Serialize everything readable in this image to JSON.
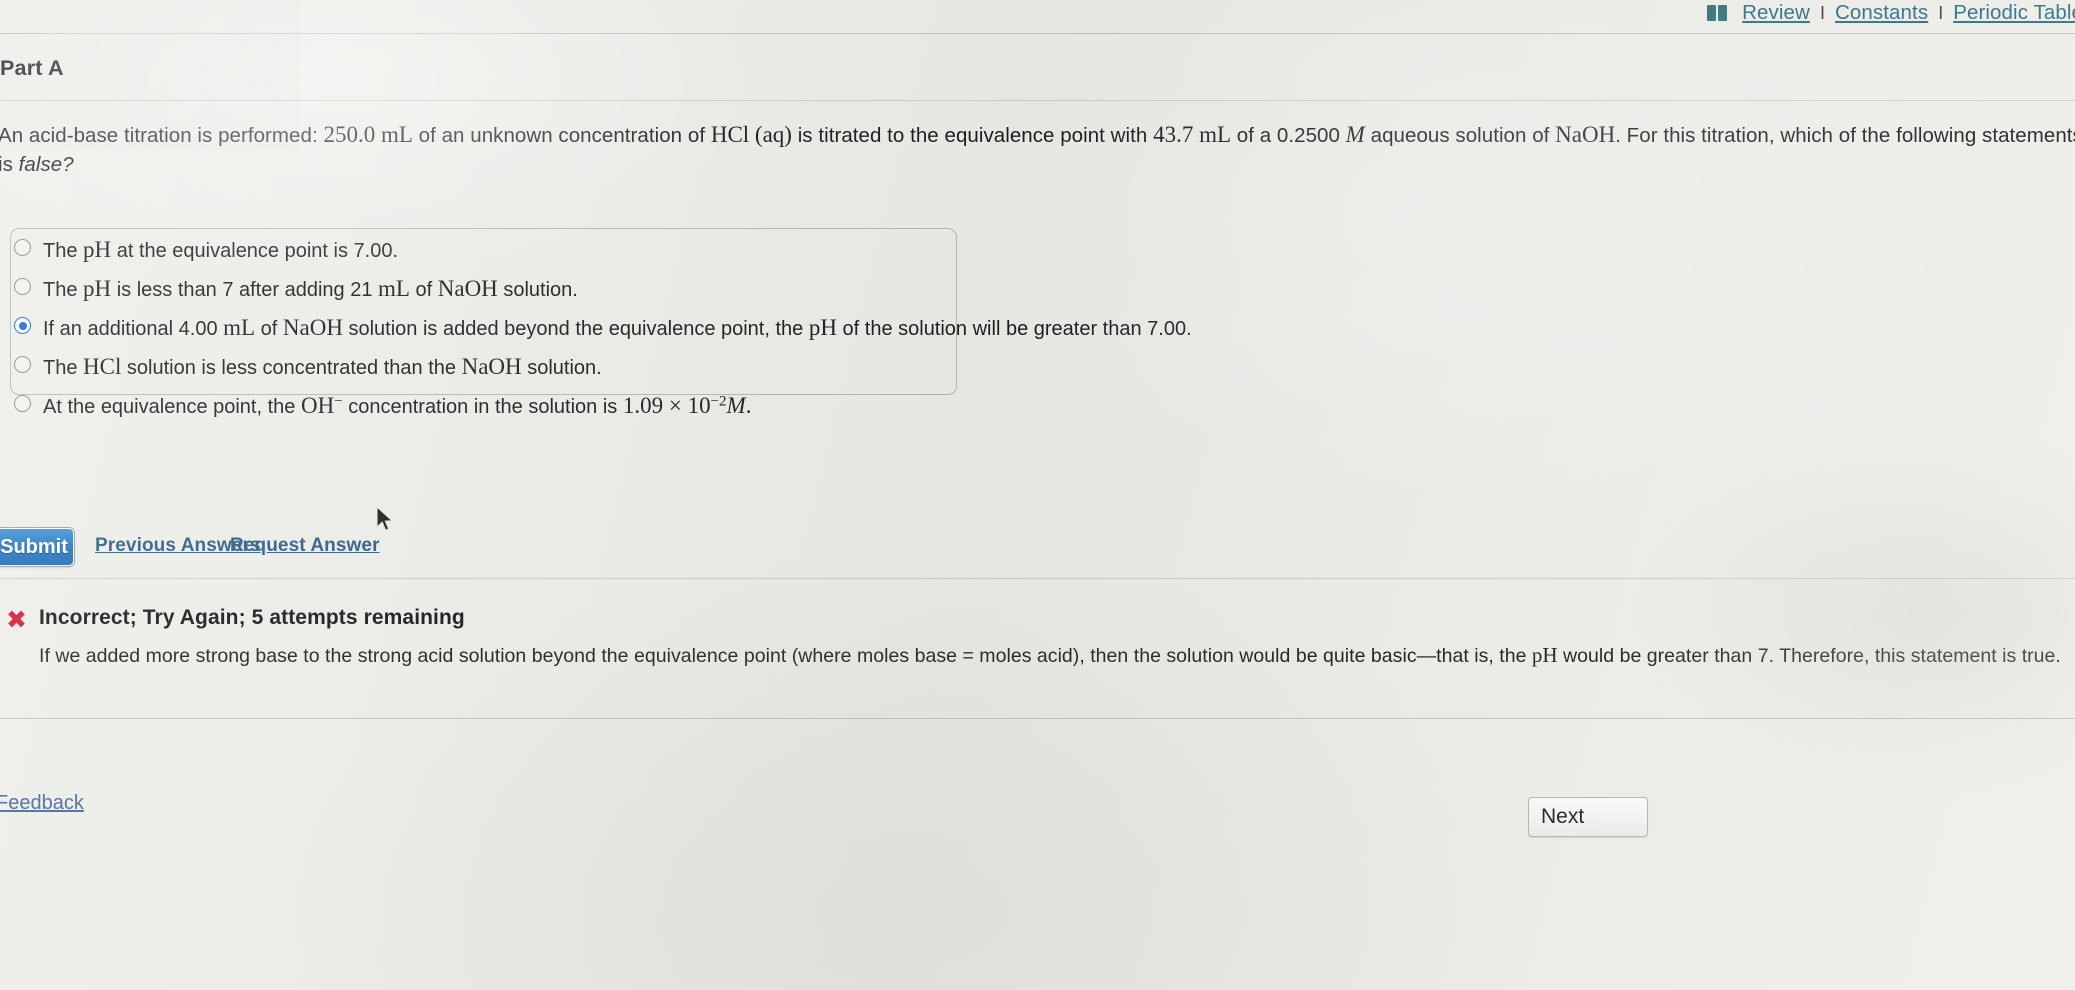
{
  "header": {
    "book_icon": "book-icon",
    "links": [
      {
        "label": "Review"
      },
      {
        "label": "Constants"
      },
      {
        "label": "Periodic Table"
      }
    ],
    "separator": "I"
  },
  "part": {
    "title": "Part A"
  },
  "question": {
    "line1_a": "An acid-base titration is performed: ",
    "m_vol1": "250.0 mL",
    "line1_b": " of an unknown concentration of ",
    "m_hcl": "HCl (aq)",
    "line1_c": " is titrated to the equivalence point with ",
    "m_vol2": "43.7 mL",
    "line1_d": " of a 0.2500 ",
    "m_molar": "M",
    "line1_e": " aqueous solution of ",
    "m_naoh": "NaOH",
    "line1_f": ". For this titration, which of the following statements is ",
    "line2": "false?"
  },
  "options": [
    {
      "id": "opt-ph-equivalence-7",
      "selected": false,
      "parts": [
        {
          "t": "The ",
          "s": "plain"
        },
        {
          "t": "pH",
          "s": "math"
        },
        {
          "t": " at the equivalence point is 7.00.",
          "s": "plain"
        }
      ]
    },
    {
      "id": "opt-ph-less-than-7",
      "selected": false,
      "parts": [
        {
          "t": "The ",
          "s": "plain"
        },
        {
          "t": "pH",
          "s": "math"
        },
        {
          "t": " is less than 7 after adding 21 ",
          "s": "plain"
        },
        {
          "t": "mL",
          "s": "math"
        },
        {
          "t": " of ",
          "s": "plain"
        },
        {
          "t": "NaOH",
          "s": "math"
        },
        {
          "t": " solution.",
          "s": "plain"
        }
      ]
    },
    {
      "id": "opt-additional-4ml",
      "selected": true,
      "parts": [
        {
          "t": "If an additional 4.00 ",
          "s": "plain"
        },
        {
          "t": "mL",
          "s": "math"
        },
        {
          "t": " of ",
          "s": "plain"
        },
        {
          "t": "NaOH",
          "s": "math"
        },
        {
          "t": " solution is added beyond the equivalence point, the ",
          "s": "plain"
        },
        {
          "t": "pH",
          "s": "math"
        },
        {
          "t": " of the solution will be greater than 7.00.",
          "s": "plain"
        }
      ]
    },
    {
      "id": "opt-hcl-less-concentrated",
      "selected": false,
      "parts": [
        {
          "t": "The ",
          "s": "plain"
        },
        {
          "t": "HCl",
          "s": "math"
        },
        {
          "t": " solution is less concentrated than the ",
          "s": "plain"
        },
        {
          "t": "NaOH",
          "s": "math"
        },
        {
          "t": " solution.",
          "s": "plain"
        }
      ]
    },
    {
      "id": "opt-oh-concentration",
      "selected": false,
      "parts": [
        {
          "t": "At the equivalence point, the ",
          "s": "plain"
        },
        {
          "t": "OH",
          "s": "math"
        },
        {
          "t": "−",
          "s": "sup"
        },
        {
          "t": " concentration in the solution is ",
          "s": "plain"
        },
        {
          "t": "1.09 × 10",
          "s": "math"
        },
        {
          "t": "−2",
          "s": "sup"
        },
        {
          "t": "M",
          "s": "mathit"
        },
        {
          "t": ".",
          "s": "math"
        }
      ]
    }
  ],
  "actions": {
    "submit_label": "Submit",
    "previous_answers_label": "Previous Answers",
    "request_answer_label": "Request Answer"
  },
  "feedback": {
    "x_icon": "✖",
    "status_color": "#d4142f",
    "title": "Incorrect; Try Again; 5 attempts remaining",
    "body": "If we added more strong base to the strong acid solution beyond the equivalence point (where moles base = moles acid), then the solution would be quite basic—that is, the pH would be greater than 7. Therefore, this statement is true."
  },
  "footer": {
    "feedback_label": "Feedback",
    "next_label": "Next"
  },
  "colors": {
    "link": "#2a6d86",
    "submit": "#1f72bf",
    "selected_radio": "#1567d3",
    "incorrect": "#d4142f"
  }
}
